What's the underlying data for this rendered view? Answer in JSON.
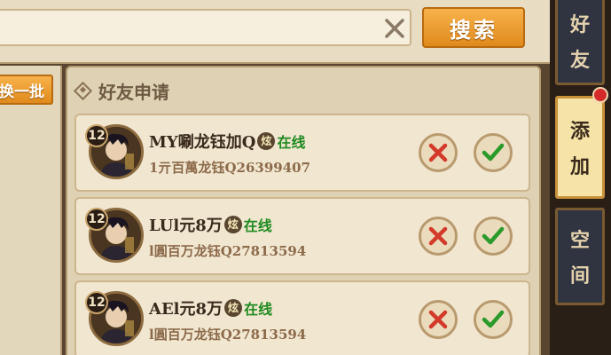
{
  "search": {
    "value": "",
    "placeholder": "",
    "button_label": "搜索"
  },
  "left": {
    "refresh_label": "换一批"
  },
  "section": {
    "title": "好友申请"
  },
  "requests": [
    {
      "level": "12",
      "name": "MY唰龙钰加Q",
      "vip": "炫",
      "status": "在线",
      "subtitle": "1亓百萬龙钰Q26399407"
    },
    {
      "level": "12",
      "name": "LUl元8万",
      "vip": "炫",
      "status": "在线",
      "subtitle": "l圓百万龙钰Q27813594"
    },
    {
      "level": "12",
      "name": "AEl元8万",
      "vip": "炫",
      "status": "在线",
      "subtitle": "l圓百万龙钰Q27813594"
    }
  ],
  "tabs": {
    "friends": [
      "好",
      "友"
    ],
    "add": [
      "添",
      "加"
    ],
    "space": [
      "空",
      "间"
    ]
  },
  "colors": {
    "accent": "#e08a1c",
    "online": "#1f8a1f",
    "reject": "#d43a2a",
    "accept": "#2a9a2a"
  }
}
